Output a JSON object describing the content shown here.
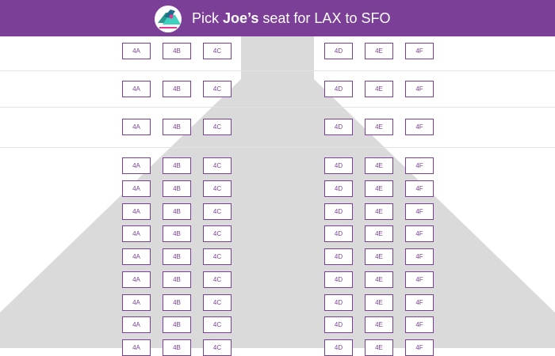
{
  "header": {
    "title_prefix": "Pick ",
    "passenger": "Joe’s",
    "title_suffix": " seat for LAX to SFO",
    "background": "#7b3f98",
    "logo_icon": "airplane-tail-logo-icon"
  },
  "seat_map": {
    "seat_color": "#7b3f98",
    "plane_color": "#dadada",
    "rows": [
      {
        "seats": [
          "4A",
          "4B",
          "4C",
          "4D",
          "4E",
          "4F"
        ]
      },
      {
        "seats": [
          "4A",
          "4B",
          "4C",
          "4D",
          "4E",
          "4F"
        ]
      },
      {
        "seats": [
          "4A",
          "4B",
          "4C",
          "4D",
          "4E",
          "4F"
        ]
      },
      {
        "seats": [
          "4A",
          "4B",
          "4C",
          "4D",
          "4E",
          "4F"
        ]
      },
      {
        "seats": [
          "4A",
          "4B",
          "4C",
          "4D",
          "4E",
          "4F"
        ]
      },
      {
        "seats": [
          "4A",
          "4B",
          "4C",
          "4D",
          "4E",
          "4F"
        ]
      },
      {
        "seats": [
          "4A",
          "4B",
          "4C",
          "4D",
          "4E",
          "4F"
        ]
      },
      {
        "seats": [
          "4A",
          "4B",
          "4C",
          "4D",
          "4E",
          "4F"
        ]
      },
      {
        "seats": [
          "4A",
          "4B",
          "4C",
          "4D",
          "4E",
          "4F"
        ]
      },
      {
        "seats": [
          "4A",
          "4B",
          "4C",
          "4D",
          "4E",
          "4F"
        ]
      },
      {
        "seats": [
          "4A",
          "4B",
          "4C",
          "4D",
          "4E",
          "4F"
        ]
      },
      {
        "seats": [
          "4A",
          "4B",
          "4C",
          "4D",
          "4E",
          "4F"
        ]
      }
    ]
  }
}
